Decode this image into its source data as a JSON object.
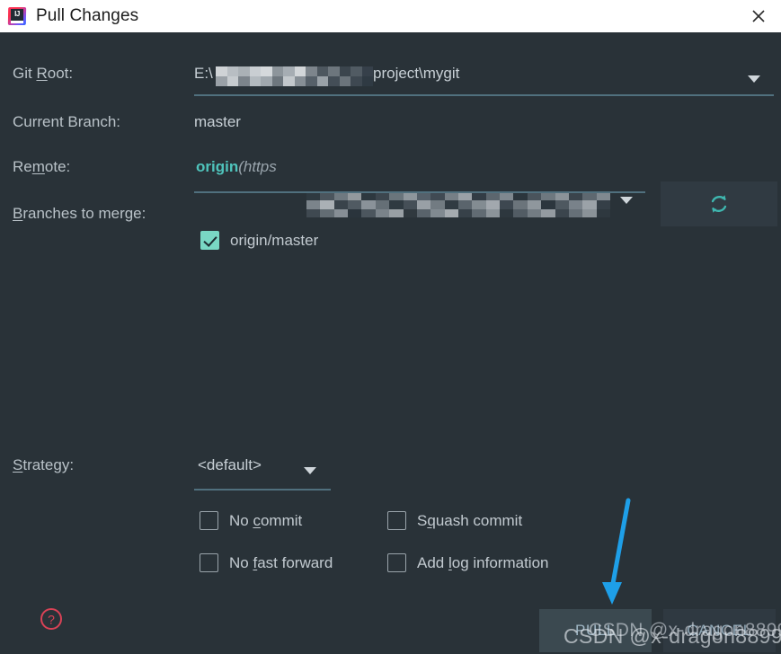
{
  "window": {
    "title": "Pull Changes",
    "icon": "intellij-idea-icon",
    "close_icon": "close-icon",
    "background_color": "#293238",
    "titlebar_color": "#ffffff"
  },
  "form": {
    "git_root": {
      "label": "Git Root:",
      "mnemonic": "R",
      "value_prefix": "E:\\",
      "value_suffix": "project\\mygit",
      "redacted": true,
      "caret_icon": "chevron-down-icon"
    },
    "current_branch": {
      "label": "Current Branch:",
      "value": "master"
    },
    "remote": {
      "label": "Remote:",
      "mnemonic": "m",
      "value_name": "origin",
      "value_url_prefix": "(https",
      "redacted": true,
      "caret_icon": "chevron-down-icon",
      "name_color": "#4fc4bc"
    },
    "refresh_button": {
      "icon": "refresh-icon",
      "color": "#3fb7b0"
    },
    "branches_to_merge": {
      "label": "Branches to merge:",
      "mnemonic": "B",
      "items": [
        {
          "label": "origin/master",
          "checked": true
        }
      ]
    },
    "strategy": {
      "label": "Strategy:",
      "mnemonic": "S",
      "value": "<default>",
      "caret_icon": "chevron-down-icon"
    },
    "options": [
      {
        "label_pre": "No ",
        "mnemonic": "c",
        "label_post": "ommit",
        "checked": false
      },
      {
        "label_pre": "S",
        "mnemonic": "q",
        "label_post": "uash commit",
        "checked": false
      },
      {
        "label_pre": "No ",
        "mnemonic": "f",
        "label_post": "ast forward",
        "checked": false
      },
      {
        "label_pre": "Add ",
        "mnemonic": "l",
        "label_post": "og information",
        "checked": false
      }
    ]
  },
  "footer": {
    "help_icon": "help-circle-icon",
    "help_color": "#d94256",
    "pull_button": "PULL",
    "cancel_button": "CANCEL"
  },
  "annotation": {
    "arrow_icon": "down-arrow-annotation",
    "arrow_color": "#1e9fe8"
  },
  "watermark": {
    "text_front": "CSDN @x-dragon8899",
    "text_back": "CSDN @x-dragon8899"
  }
}
